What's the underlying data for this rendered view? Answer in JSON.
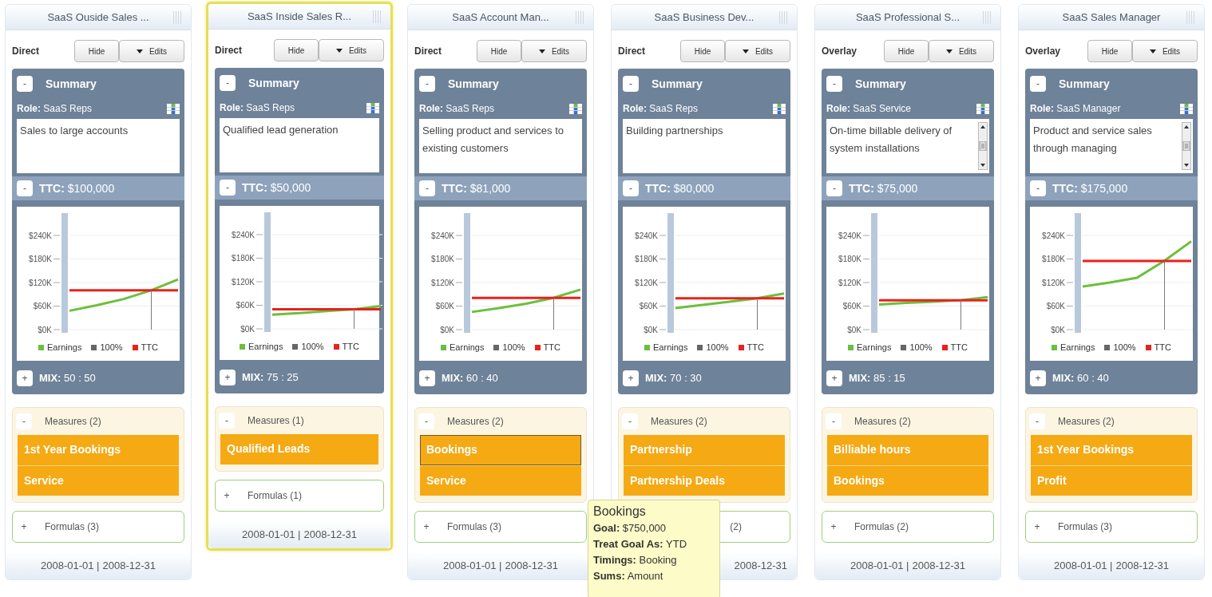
{
  "columns": [
    {
      "title": "SaaS Ouside Sales ...",
      "selected": false,
      "mode": "Direct",
      "hide_button": "Hide",
      "edits_button": "Edits",
      "summary_toggle": "-",
      "summary_label": "Summary",
      "role": "**Role:** SaaS Reps",
      "description": "Sales to large accounts",
      "scrollable": false,
      "ttc_toggle": "-",
      "ttc": "**TTC:** $100,000",
      "chart_data": {
        "type": "line",
        "grid": true,
        "legend": true,
        "ylim": [
          0,
          240
        ],
        "yticks": [
          {
            "value": 0,
            "label": "$0K"
          },
          {
            "value": 60,
            "label": "$60K"
          },
          {
            "value": 120,
            "label": "$120K"
          },
          {
            "value": 180,
            "label": "$180K"
          },
          {
            "value": 240,
            "label": "$240K"
          }
        ],
        "series": [
          {
            "name": "Earnings",
            "color": "#6cbf3c",
            "values": [
              48,
              62,
              78,
              100,
              128
            ]
          },
          {
            "name": "TTC",
            "color": "#e8221c",
            "values": [
              100,
              100,
              100,
              100,
              100
            ]
          }
        ]
      },
      "legend_marker": {
        "label": "100%"
      },
      "mix_toggle": "+",
      "mix": "**MIX:** 50 : 50",
      "measures_toggle": "-",
      "measures_label": "Measures (2)",
      "measures": [
        {
          "label": "1st Year Bookings",
          "selected": false
        },
        {
          "label": "Service",
          "selected": false
        }
      ],
      "formulas_toggle": "+",
      "formulas_label": "Formulas (3)",
      "date_start": "2008-01-01 |",
      "date_end": "2008-12-31"
    },
    {
      "title": "SaaS Inside Sales R...",
      "selected": true,
      "mode": "Direct",
      "hide_button": "Hide",
      "edits_button": "Edits",
      "summary_toggle": "-",
      "summary_label": "Summary",
      "role": "**Role:** SaaS Reps",
      "description": "Qualified lead generation",
      "scrollable": false,
      "ttc_toggle": "-",
      "ttc": "**TTC:** $50,000",
      "chart_data": {
        "type": "line",
        "grid": true,
        "legend": true,
        "ylim": [
          0,
          240
        ],
        "yticks": [
          {
            "value": 0,
            "label": "$0K"
          },
          {
            "value": 60,
            "label": "$60K"
          },
          {
            "value": 120,
            "label": "$120K"
          },
          {
            "value": 180,
            "label": "$180K"
          },
          {
            "value": 240,
            "label": "$240K"
          }
        ],
        "series": [
          {
            "name": "Earnings",
            "color": "#6cbf3c",
            "values": [
              36,
              40,
              45,
              50,
              58
            ]
          },
          {
            "name": "TTC",
            "color": "#e8221c",
            "values": [
              50,
              50,
              50,
              50,
              50
            ]
          }
        ]
      },
      "legend_marker": {
        "label": "100%"
      },
      "mix_toggle": "+",
      "mix": "**MIX:** 75 : 25",
      "measures_toggle": "-",
      "measures_label": "Measures (1)",
      "measures": [
        {
          "label": "Qualified Leads",
          "selected": false
        }
      ],
      "formulas_toggle": "+",
      "formulas_label": "Formulas (1)",
      "date_start": "2008-01-01 |",
      "date_end": "2008-12-31"
    },
    {
      "title": "SaaS Account Man...",
      "selected": false,
      "mode": "Direct",
      "hide_button": "Hide",
      "edits_button": "Edits",
      "summary_toggle": "-",
      "summary_label": "Summary",
      "role": "**Role:** SaaS Reps",
      "description": "Selling product and services to existing customers",
      "scrollable": false,
      "ttc_toggle": "-",
      "ttc": "**TTC:** $81,000",
      "chart_data": {
        "type": "line",
        "grid": true,
        "legend": true,
        "ylim": [
          0,
          240
        ],
        "yticks": [
          {
            "value": 0,
            "label": "$0K"
          },
          {
            "value": 60,
            "label": "$60K"
          },
          {
            "value": 120,
            "label": "$120K"
          },
          {
            "value": 180,
            "label": "$180K"
          },
          {
            "value": 240,
            "label": "$240K"
          }
        ],
        "series": [
          {
            "name": "Earnings",
            "color": "#6cbf3c",
            "values": [
              45,
              55,
              66,
              81,
              102
            ]
          },
          {
            "name": "TTC",
            "color": "#e8221c",
            "values": [
              81,
              81,
              81,
              81,
              81
            ]
          }
        ]
      },
      "legend_marker": {
        "label": "100%"
      },
      "mix_toggle": "+",
      "mix": "**MIX:** 60 : 40",
      "measures_toggle": "-",
      "measures_label": "Measures (2)",
      "measures": [
        {
          "label": "Bookings",
          "selected": true
        },
        {
          "label": "Service",
          "selected": false
        }
      ],
      "formulas_toggle": "+",
      "formulas_label": "Formulas (3)",
      "date_start": "2008-01-01 |",
      "date_end": "2008-12-31"
    },
    {
      "title": "SaaS Business Dev...",
      "selected": false,
      "mode": "Direct",
      "hide_button": "Hide",
      "edits_button": "Edits",
      "summary_toggle": "-",
      "summary_label": "Summary",
      "role": "**Role:** SaaS Reps",
      "description": "Building partnerships",
      "scrollable": false,
      "ttc_toggle": "-",
      "ttc": "**TTC:** $80,000",
      "chart_data": {
        "type": "line",
        "grid": true,
        "legend": true,
        "ylim": [
          0,
          240
        ],
        "yticks": [
          {
            "value": 0,
            "label": "$0K"
          },
          {
            "value": 60,
            "label": "$60K"
          },
          {
            "value": 120,
            "label": "$120K"
          },
          {
            "value": 180,
            "label": "$180K"
          },
          {
            "value": 240,
            "label": "$240K"
          }
        ],
        "series": [
          {
            "name": "Earnings",
            "color": "#6cbf3c",
            "values": [
              55,
              63,
              71,
              80,
              92
            ]
          },
          {
            "name": "TTC",
            "color": "#e8221c",
            "values": [
              80,
              80,
              80,
              80,
              80
            ]
          }
        ]
      },
      "legend_marker": {
        "label": "100%"
      },
      "mix_toggle": "+",
      "mix": "**MIX:** 70 : 30",
      "measures_toggle": "-",
      "measures_label": "Measures (2)",
      "measures": [
        {
          "label": "Partnership",
          "selected": false
        },
        {
          "label": "Partnership Deals",
          "selected": false
        }
      ],
      "formulas_label": "(2)",
      "date_end": "2008-12-31"
    },
    {
      "title": "SaaS Professional S...",
      "selected": false,
      "mode": "Overlay",
      "hide_button": "Hide",
      "edits_button": "Edits",
      "summary_toggle": "-",
      "summary_label": "Summary",
      "role": "**Role:** SaaS Service",
      "description": "On-time billable delivery of system installations",
      "scrollable": true,
      "ttc_toggle": "-",
      "ttc": "**TTC:** $75,000",
      "chart_data": {
        "type": "line",
        "grid": true,
        "legend": true,
        "ylim": [
          0,
          240
        ],
        "yticks": [
          {
            "value": 0,
            "label": "$0K"
          },
          {
            "value": 60,
            "label": "$60K"
          },
          {
            "value": 120,
            "label": "$120K"
          },
          {
            "value": 180,
            "label": "$180K"
          },
          {
            "value": 240,
            "label": "$240K"
          }
        ],
        "series": [
          {
            "name": "Earnings",
            "color": "#6cbf3c",
            "values": [
              64,
              68,
              71,
              75,
              83
            ]
          },
          {
            "name": "TTC",
            "color": "#e8221c",
            "values": [
              75,
              75,
              75,
              75,
              75
            ]
          }
        ]
      },
      "legend_marker": {
        "label": "100%"
      },
      "mix_toggle": "+",
      "mix": "**MIX:** 85 : 15",
      "measures_toggle": "-",
      "measures_label": "Measures (2)",
      "measures": [
        {
          "label": "Billiable hours",
          "selected": false
        },
        {
          "label": "Bookings",
          "selected": false
        }
      ],
      "formulas_toggle": "+",
      "formulas_label": "Formulas (2)",
      "date_start": "2008-01-01 |",
      "date_end": "2008-12-31"
    },
    {
      "title": "SaaS Sales Manager",
      "selected": false,
      "mode": "Overlay",
      "hide_button": "Hide",
      "edits_button": "Edits",
      "summary_toggle": "-",
      "summary_label": "Summary",
      "role": "**Role:** SaaS Manager",
      "description": "Product and service sales through managing",
      "scrollable": true,
      "ttc_toggle": "-",
      "ttc": "**TTC:** $175,000",
      "chart_data": {
        "type": "line",
        "grid": true,
        "legend": true,
        "ylim": [
          0,
          240
        ],
        "yticks": [
          {
            "value": 0,
            "label": "$0K"
          },
          {
            "value": 60,
            "label": "$60K"
          },
          {
            "value": 120,
            "label": "$120K"
          },
          {
            "value": 180,
            "label": "$180K"
          },
          {
            "value": 240,
            "label": "$240K"
          }
        ],
        "series": [
          {
            "name": "Earnings",
            "color": "#6cbf3c",
            "values": [
              110,
              120,
              132,
              175,
              225
            ]
          },
          {
            "name": "TTC",
            "color": "#e8221c",
            "values": [
              175,
              175,
              175,
              175,
              175
            ]
          }
        ]
      },
      "legend_marker": {
        "label": "100%"
      },
      "mix_toggle": "+",
      "mix": "**MIX:** 60 : 40",
      "measures_toggle": "-",
      "measures_label": "Measures (2)",
      "measures": [
        {
          "label": "1st Year Bookings",
          "selected": false
        },
        {
          "label": "Profit",
          "selected": false
        }
      ],
      "formulas_toggle": "+",
      "formulas_label": "Formulas (3)",
      "date_start": "2008-01-01 |",
      "date_end": "2008-12-31"
    }
  ],
  "tooltip": {
    "title": "Bookings",
    "lines": [
      "**Goal:** $750,000",
      "**Treat Goal As:** YTD",
      "**Timings:** Booking",
      "**Sums:** Amount"
    ]
  }
}
